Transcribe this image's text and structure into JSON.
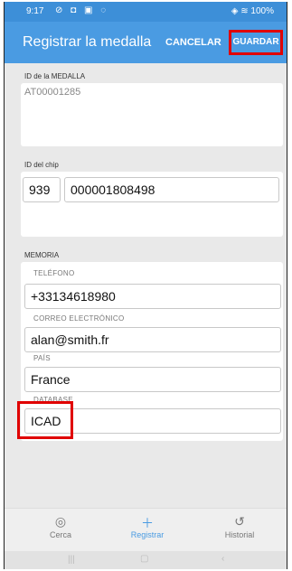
{
  "status": {
    "time": "9:17",
    "icons": "⊘ ◘ ▣ ◌",
    "right": "◈ ≋ 100%"
  },
  "appbar": {
    "title": "Registrar la medalla",
    "cancel": "CANCELAR",
    "save": "GUARDAR"
  },
  "medal": {
    "section_label": "ID de la MEDALLA",
    "value": "AT00001285"
  },
  "chip": {
    "section_label": "ID del chip",
    "prefix": "939",
    "number": "000001808498"
  },
  "memory": {
    "section_label": "MEMORIA",
    "phone_label": "TELÉFONO",
    "phone": "+33134618980",
    "email_label": "CORREO ELECTRÓNICO",
    "email": "alan@smith.fr",
    "country_label": "PAÍS",
    "country": "France",
    "database_label": "DATABASE",
    "database": "ICAD"
  },
  "nav": {
    "near": "Cerca",
    "register": "Registrar",
    "history": "Historial"
  },
  "colors": {
    "primary": "#4a9be2",
    "highlight": "#e00000"
  }
}
